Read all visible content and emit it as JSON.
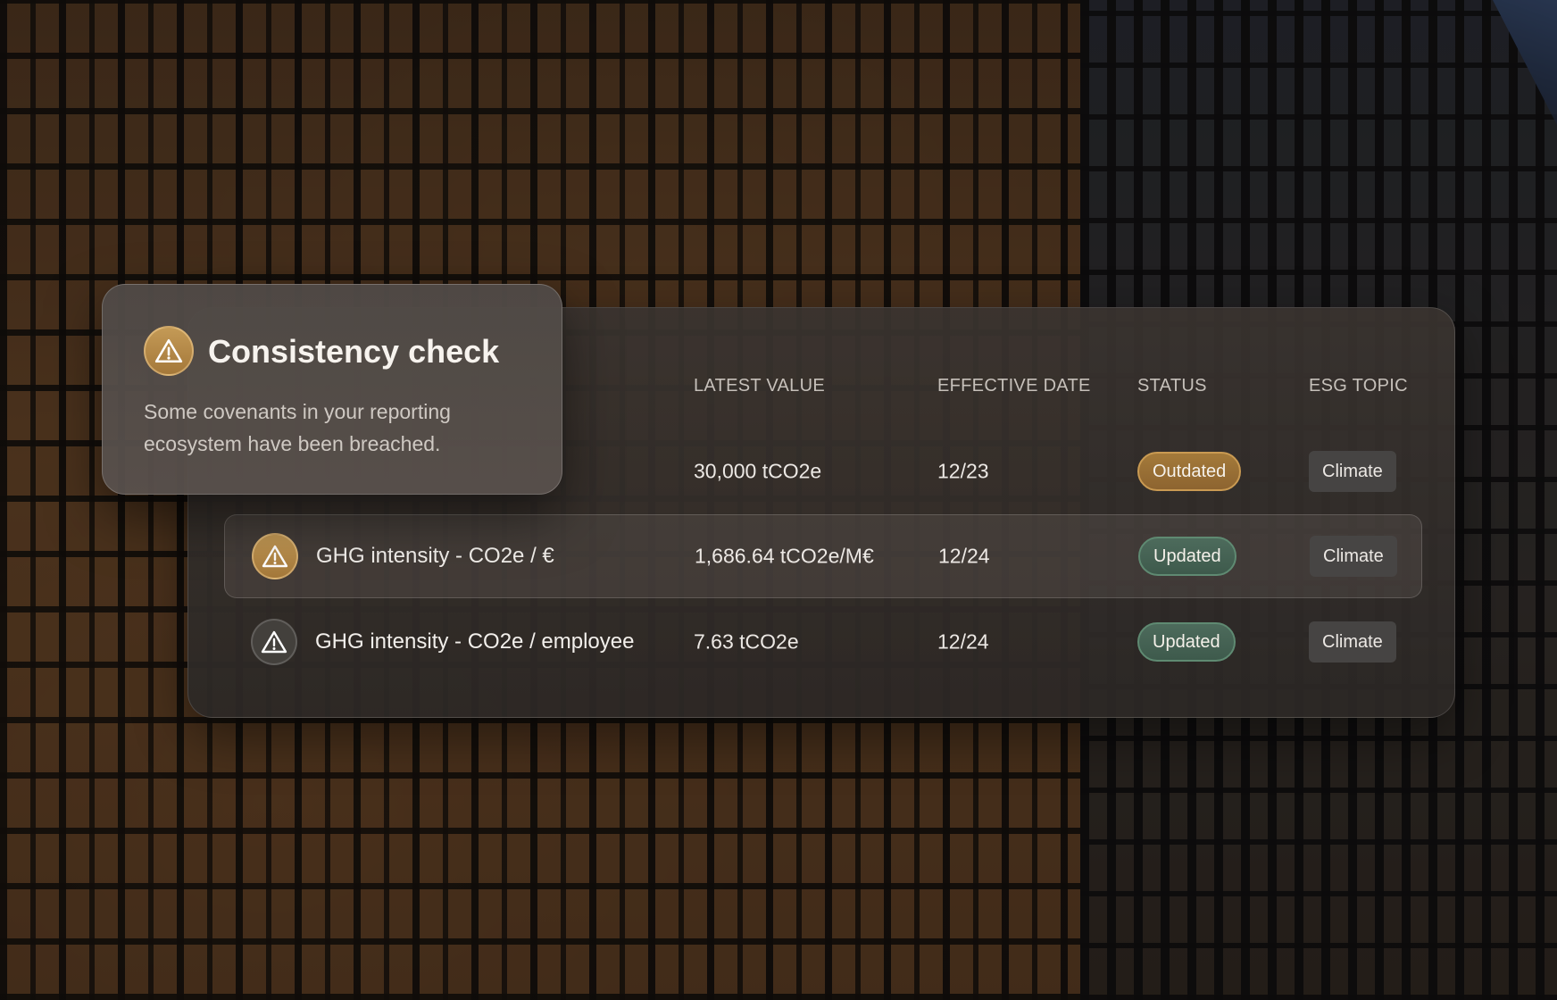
{
  "popover": {
    "title": "Consistency check",
    "message": "Some covenants in your reporting ecosystem have been breached.",
    "icon": "warning-icon"
  },
  "table": {
    "columns": {
      "latest_value": "LATEST VALUE",
      "effective_date": "EFFECTIVE DATE",
      "status": "STATUS",
      "esg_topic": "ESG TOPIC"
    },
    "rows": [
      {
        "name": "",
        "latest_value": "30,000 tCO2e",
        "effective_date": "12/23",
        "status": "Outdated",
        "esg_topic": "Climate"
      },
      {
        "name": "GHG intensity - CO2e / €",
        "latest_value": "1,686.64 tCO2e/M€",
        "effective_date": "12/24",
        "status": "Updated",
        "esg_topic": "Climate",
        "icon": "warning-icon"
      },
      {
        "name": "GHG intensity - CO2e / employee",
        "latest_value": "7.63 tCO2e",
        "effective_date": "12/24",
        "status": "Updated",
        "esg_topic": "Climate",
        "icon": "warning-icon"
      }
    ]
  },
  "colors": {
    "outdated": "#a47a3a",
    "updated": "#4d6b5c",
    "warning_gold": "#c49a56"
  }
}
